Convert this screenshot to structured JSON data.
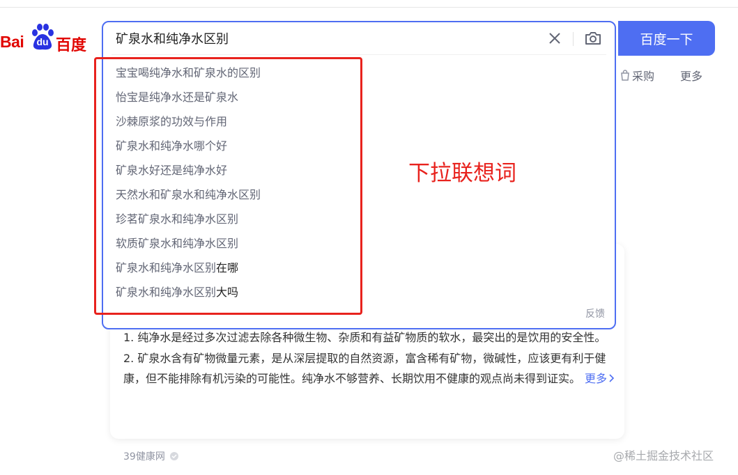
{
  "logo": {
    "latin": "Bai",
    "du": "du",
    "chinese": "百度"
  },
  "search": {
    "query": "矿泉水和纯净水区别",
    "button_label": "百度一下"
  },
  "suggestions": [
    {
      "text": "宝宝喝纯净水和矿泉水的区别",
      "tail": ""
    },
    {
      "text": "怡宝是纯净水还是矿泉水",
      "tail": ""
    },
    {
      "text": "沙棘原浆的功效与作用",
      "tail": ""
    },
    {
      "text": "矿泉水和纯净水哪个好",
      "tail": ""
    },
    {
      "text": "矿泉水好还是纯净水好",
      "tail": ""
    },
    {
      "text": "天然水和矿泉水和纯净水区别",
      "tail": ""
    },
    {
      "text": "珍茗矿泉水和纯净水区别",
      "tail": ""
    },
    {
      "text": "软质矿泉水和纯净水区别",
      "tail": ""
    },
    {
      "text": "矿泉水和纯净水区别",
      "tail": "在哪"
    },
    {
      "text": "矿泉水和纯净水区别",
      "tail": "大吗"
    }
  ],
  "feedback_label": "反馈",
  "tabs": {
    "caigou": "采购",
    "more": "更多"
  },
  "annotation": {
    "label": "下拉联想词",
    "color": "#e8221d"
  },
  "answer": {
    "line1": "1. 纯净水是经过多次过滤去除各种微生物、杂质和有益矿物质的软水，最突出的是饮用的安全性。",
    "line2": "2. 矿泉水含有矿物微量元素，是从深层提取的自然资源，富含稀有矿物，微碱性，应该更有利于健康，但不能排除有机污染的可能性。纯净水不够营养、长期饮用不健康的观点尚未得到证实。",
    "more_label": "更多"
  },
  "source_label": "39健康网",
  "watermark": "@稀土掘金技术社区",
  "colors": {
    "accent": "#4e6ef2",
    "brand_red": "#e10602"
  }
}
